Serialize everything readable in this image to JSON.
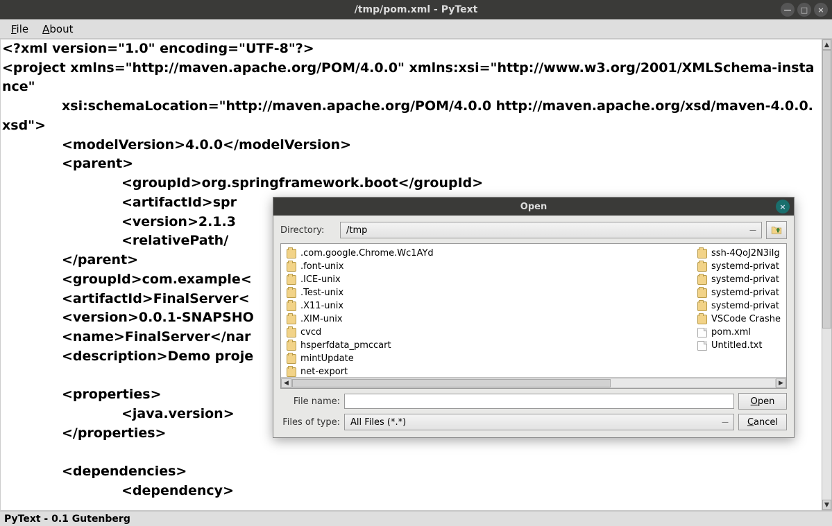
{
  "window": {
    "title": "/tmp/pom.xml - PyText",
    "controls": {
      "minimize": "—",
      "maximize": "□",
      "close": "×"
    }
  },
  "menubar": {
    "file": "File",
    "about": "About"
  },
  "editor": {
    "lines": [
      "<?xml version=\"1.0\" encoding=\"UTF-8\"?>",
      "<project xmlns=\"http://maven.apache.org/POM/4.0.0\" xmlns:xsi=\"http://www.w3.org/2001/XMLSchema-instance\"",
      "             xsi:schemaLocation=\"http://maven.apache.org/POM/4.0.0 http://maven.apache.org/xsd/maven-4.0.0.xsd\">",
      "             <modelVersion>4.0.0</modelVersion>",
      "             <parent>",
      "                          <groupId>org.springframework.boot</groupId>",
      "                          <artifactId>spr",
      "                          <version>2.1.3",
      "                          <relativePath/",
      "             </parent>",
      "             <groupId>com.example<",
      "             <artifactId>FinalServer<",
      "             <version>0.0.1-SNAPSHO",
      "             <name>FinalServer</nar",
      "             <description>Demo proje",
      "",
      "             <properties>",
      "                          <java.version>",
      "             </properties>",
      "",
      "             <dependencies>",
      "                          <dependency>"
    ]
  },
  "statusbar": {
    "text": "PyText - 0.1 Gutenberg"
  },
  "dialog": {
    "title": "Open",
    "directory_label": "Directory:",
    "directory_value": "/tmp",
    "filename_label": "File name:",
    "filename_value": "",
    "types_label": "Files of type:",
    "types_value": "All Files (*.*)",
    "open_btn": "Open",
    "cancel_btn": "Cancel",
    "cols": [
      [
        {
          "name": ".com.google.Chrome.Wc1AYd",
          "type": "folder"
        },
        {
          "name": ".font-unix",
          "type": "folder"
        },
        {
          "name": ".ICE-unix",
          "type": "folder"
        },
        {
          "name": ".Test-unix",
          "type": "folder"
        },
        {
          "name": ".X11-unix",
          "type": "folder"
        },
        {
          "name": ".XIM-unix",
          "type": "folder"
        },
        {
          "name": "cvcd",
          "type": "folder"
        },
        {
          "name": "hsperfdata_pmccart",
          "type": "folder"
        },
        {
          "name": "mintUpdate",
          "type": "folder"
        },
        {
          "name": "net-export",
          "type": "folder"
        }
      ],
      [
        {
          "name": "ssh-4QoJ2N3iIg",
          "type": "folder"
        },
        {
          "name": "systemd-privat",
          "type": "folder"
        },
        {
          "name": "systemd-privat",
          "type": "folder"
        },
        {
          "name": "systemd-privat",
          "type": "folder"
        },
        {
          "name": "systemd-privat",
          "type": "folder"
        },
        {
          "name": "VSCode Crashe",
          "type": "folder"
        },
        {
          "name": "pom.xml",
          "type": "file"
        },
        {
          "name": "Untitled.txt",
          "type": "file"
        }
      ]
    ]
  }
}
